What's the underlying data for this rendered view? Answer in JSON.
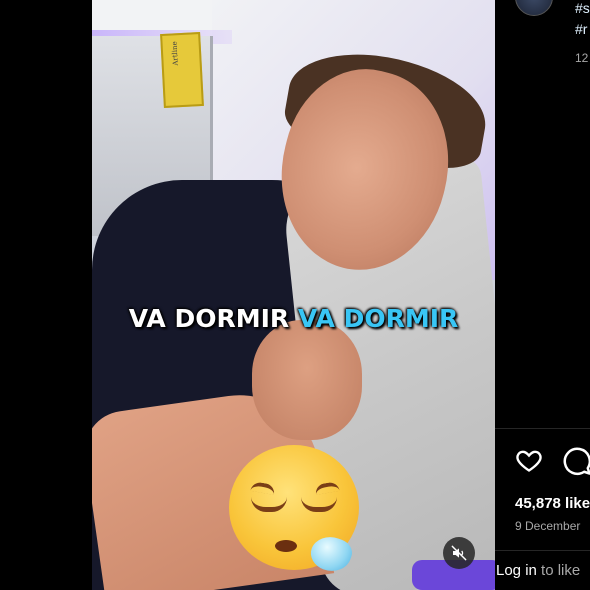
{
  "video": {
    "caption_white": "VA DORMIR",
    "caption_blue": "VA DORMIR",
    "sign_text": "Artline",
    "emoji": "sleepy-face",
    "mute_icon": "muted-speaker-icon"
  },
  "post": {
    "tag_line_1": "#s",
    "tag_line_2": "#r",
    "meta_number": "12",
    "likes": "45,878 like",
    "date": "9 December",
    "login_link": "Log in",
    "login_rest": " to like"
  },
  "colors": {
    "caption_blue": "#39c6f5",
    "background": "#000000",
    "hashtag": "#e0f1ff"
  }
}
